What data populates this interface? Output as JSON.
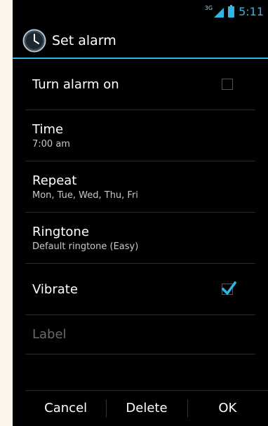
{
  "status_bar": {
    "network": "3G",
    "time": "5:11",
    "accent": "#33b5e5"
  },
  "dialog": {
    "title": "Set alarm",
    "icon": "clock-icon"
  },
  "settings": {
    "turn_on": {
      "label": "Turn alarm on",
      "checked": false
    },
    "time": {
      "label": "Time",
      "value": "7:00 am"
    },
    "repeat": {
      "label": "Repeat",
      "value": "Mon, Tue, Wed, Thu, Fri"
    },
    "ringtone": {
      "label": "Ringtone",
      "value": "Default ringtone (Easy)"
    },
    "vibrate": {
      "label": "Vibrate",
      "checked": true
    },
    "label": {
      "placeholder": "Label"
    }
  },
  "buttons": {
    "cancel": "Cancel",
    "delete": "Delete",
    "ok": "OK"
  }
}
